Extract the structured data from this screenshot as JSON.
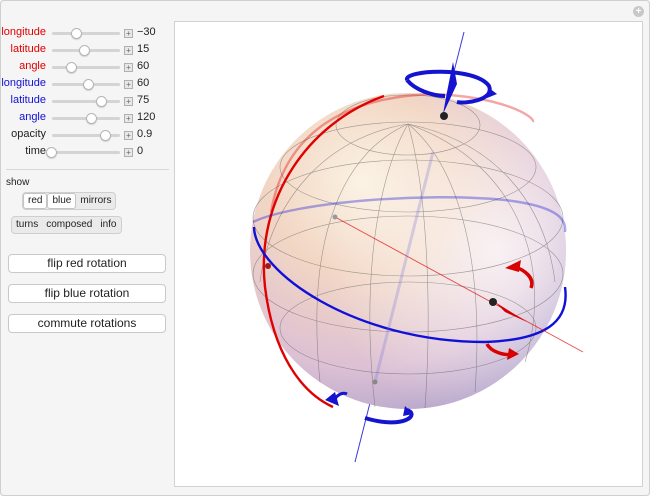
{
  "colors": {
    "red": "#e00000",
    "blue": "#1010d8"
  },
  "sliders": [
    {
      "label": "longitude",
      "color": "#e00000",
      "value": "−30",
      "pos": 0.42
    },
    {
      "label": "latitude",
      "color": "#e00000",
      "value": "15",
      "pos": 0.55
    },
    {
      "label": "angle",
      "color": "#e00000",
      "value": "60",
      "pos": 0.33
    },
    {
      "label": "longitude",
      "color": "#1010d8",
      "value": "60",
      "pos": 0.62
    },
    {
      "label": "latitude",
      "color": "#1010d8",
      "value": "75",
      "pos": 0.83
    },
    {
      "label": "angle",
      "color": "#1010d8",
      "value": "120",
      "pos": 0.66
    },
    {
      "label": "opacity",
      "color": "#222222",
      "value": "0.9",
      "pos": 0.9
    },
    {
      "label": "time",
      "color": "#222222",
      "value": "0",
      "pos": 0.0
    }
  ],
  "show": {
    "label": "show",
    "options1": [
      "red",
      "blue",
      "mirrors"
    ],
    "options2": [
      "turns",
      "composed",
      "info"
    ]
  },
  "buttons": {
    "flip_red": "flip red rotation",
    "flip_blue": "flip blue rotation",
    "commute": "commute rotations"
  }
}
